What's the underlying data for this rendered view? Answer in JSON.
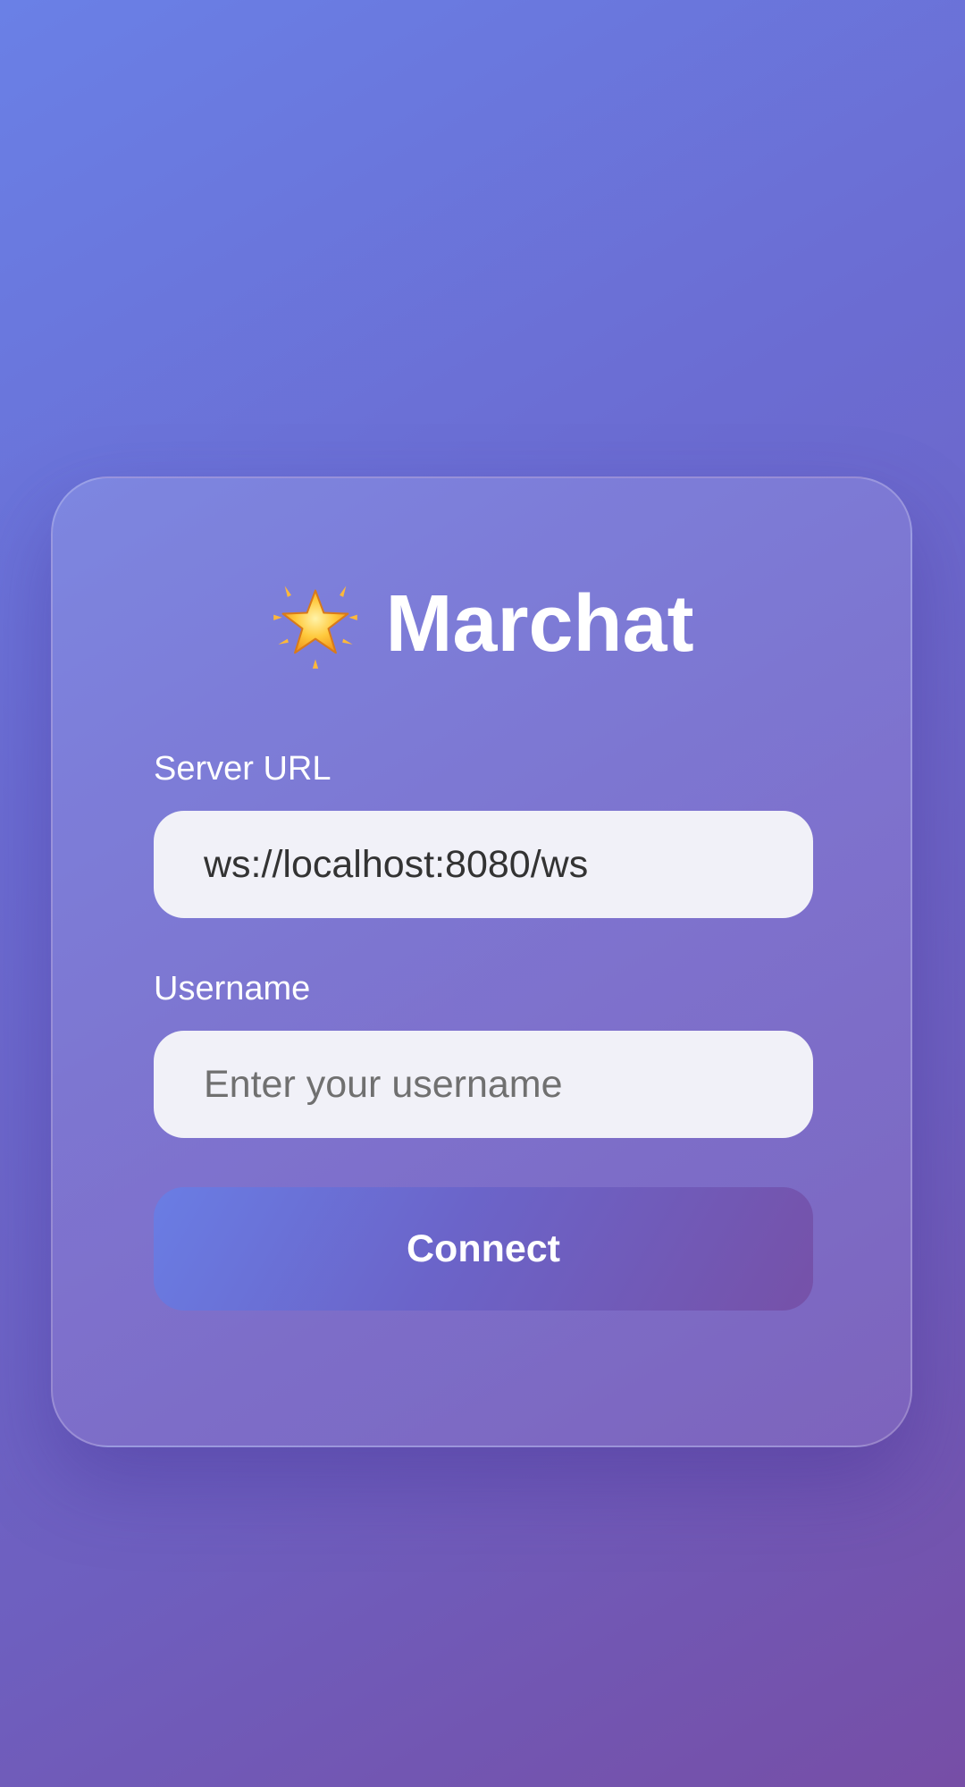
{
  "app": {
    "title": "Marchat",
    "logo_icon": "glowing-star-icon"
  },
  "form": {
    "server_url": {
      "label": "Server URL",
      "value": "ws://localhost:8080/ws",
      "placeholder": ""
    },
    "username": {
      "label": "Username",
      "value": "",
      "placeholder": "Enter your username"
    },
    "connect_label": "Connect"
  },
  "colors": {
    "background_start": "#6a80e6",
    "background_end": "#764ea6",
    "input_background": "#f1f1f8",
    "button_start": "#6a7de4",
    "button_end": "#7651a8",
    "text_light": "#ffffff"
  }
}
